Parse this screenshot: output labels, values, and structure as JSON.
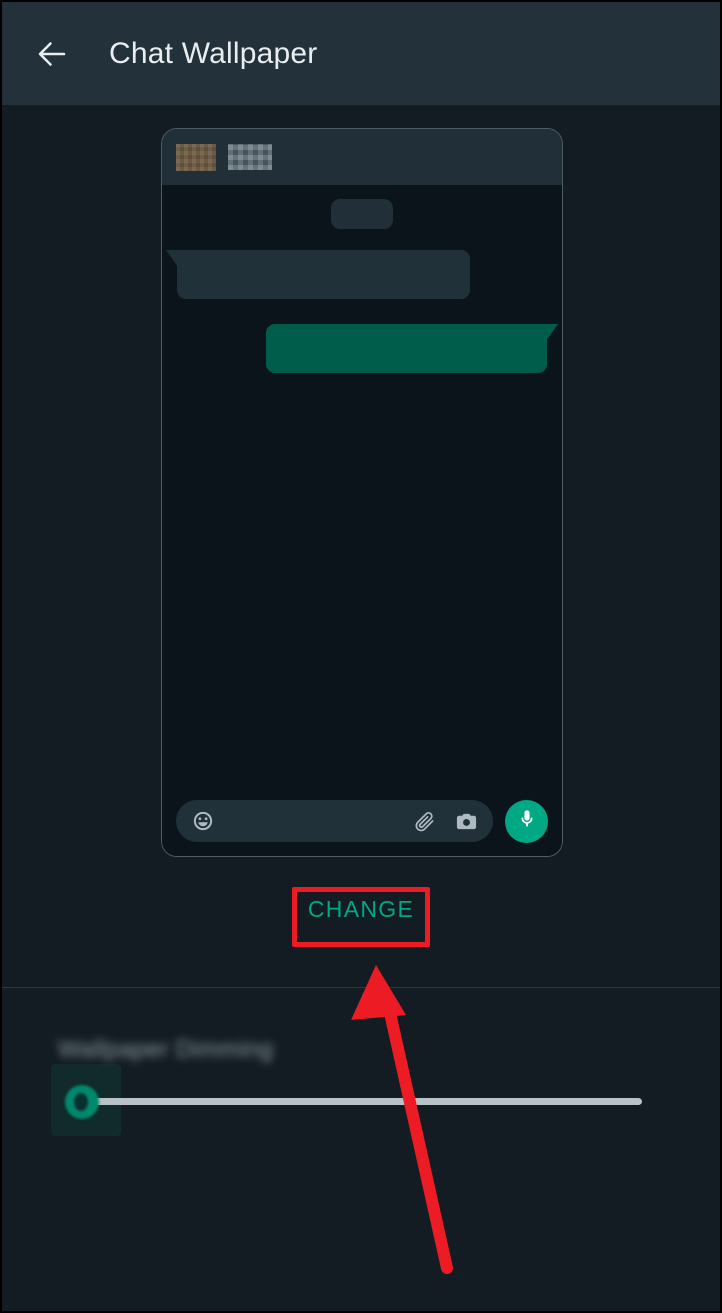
{
  "app": {
    "title": "Chat Wallpaper"
  },
  "header": {
    "back_icon": "arrow-left-icon",
    "title": "Chat Wallpaper"
  },
  "preview": {
    "header": {
      "avatar_icon": "contact-avatar-censored",
      "contact_name": "",
      "contact_name_state": "blurred"
    },
    "date_pill": "",
    "messages": [
      {
        "direction": "incoming",
        "text": ""
      },
      {
        "direction": "outgoing",
        "text": ""
      }
    ],
    "input_bar": {
      "emoji_icon": "emoji-smiley-icon",
      "attach_icon": "paperclip-icon",
      "camera_icon": "camera-icon",
      "mic_icon": "microphone-icon",
      "placeholder": ""
    }
  },
  "actions": {
    "change_label": "CHANGE"
  },
  "dimming": {
    "label": "Wallpaper Dimming",
    "slider_value": 0,
    "slider_min": 0,
    "slider_max": 100
  },
  "annotations": {
    "highlight_target": "CHANGE",
    "arrow_points_to": "CHANGE"
  },
  "colors": {
    "appbar": "#22313a",
    "page_background": "#131c23",
    "preview_chat_background": "#0b141a",
    "preview_header": "#212f38",
    "bubble_incoming": "#21313a",
    "bubble_outgoing": "#005c4b",
    "accent_teal": "#00a884",
    "annotation_red": "#ed1c24",
    "slider_track": "#b8c2c7",
    "title_text": "#e9edef"
  }
}
